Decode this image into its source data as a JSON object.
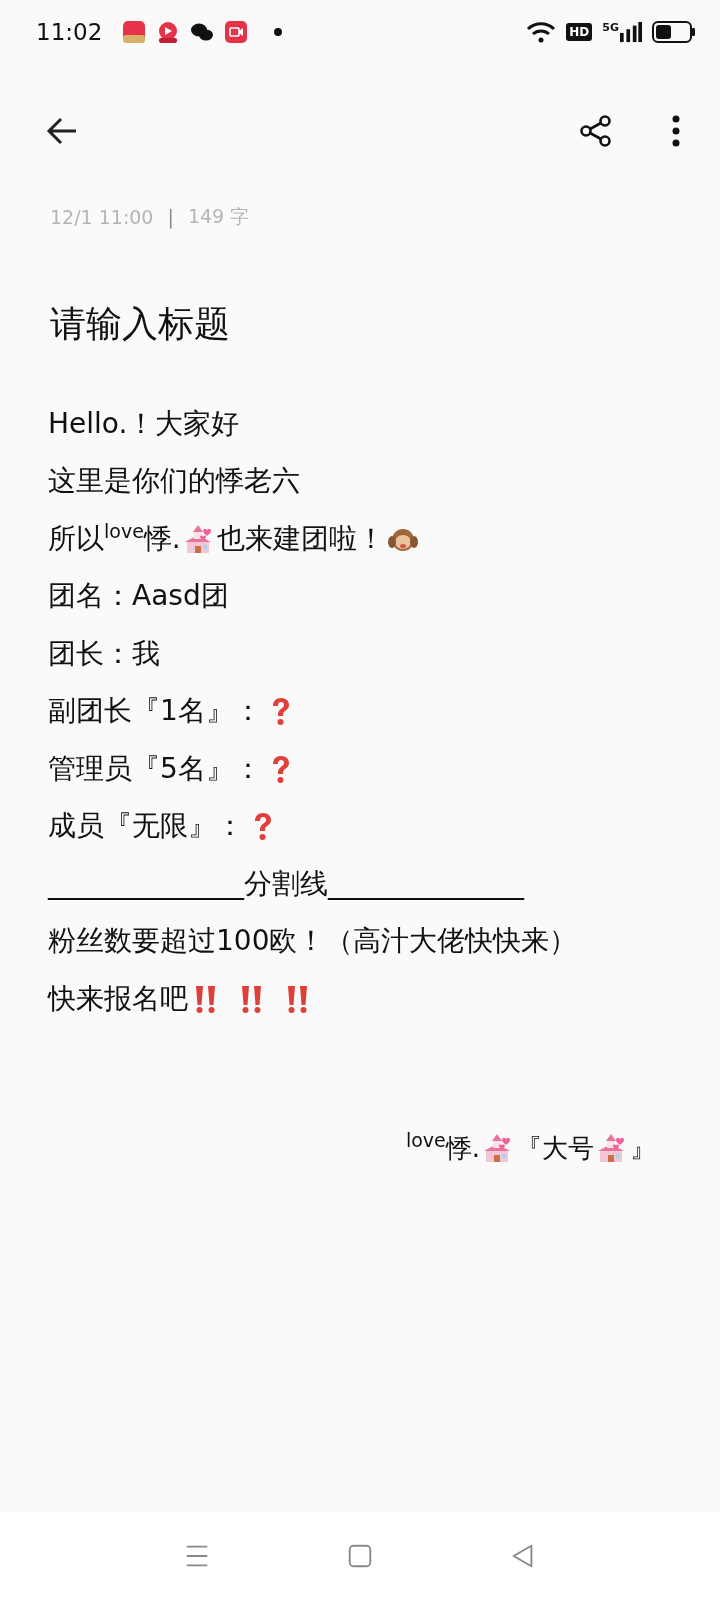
{
  "status_bar": {
    "time": "11:02",
    "hd": "HD",
    "network": "5G"
  },
  "note": {
    "date": "12/1 11:00",
    "separator": "|",
    "count": "149 字",
    "title": "请输入标题",
    "lines": [
      {
        "parts": [
          {
            "kind": "text",
            "text": "Hello.！大家好"
          }
        ]
      },
      {
        "parts": [
          {
            "kind": "text",
            "text": "这里是你们的悸老六"
          }
        ]
      },
      {
        "parts": [
          {
            "kind": "text",
            "text": "所以$^{love}$悸."
          },
          {
            "kind": "chapel"
          },
          {
            "kind": "text",
            "text": "也来建团啦！"
          },
          {
            "kind": "monkey"
          }
        ]
      },
      {
        "parts": [
          {
            "kind": "text",
            "text": "团名：Aasd团"
          }
        ]
      },
      {
        "parts": [
          {
            "kind": "text",
            "text": "团长：我"
          }
        ]
      },
      {
        "parts": [
          {
            "kind": "text",
            "text": "副团长『1名』："
          },
          {
            "kind": "question"
          }
        ]
      },
      {
        "parts": [
          {
            "kind": "text",
            "text": "管理员『5名』："
          },
          {
            "kind": "question"
          }
        ]
      },
      {
        "parts": [
          {
            "kind": "text",
            "text": "成员『无限』："
          },
          {
            "kind": "question"
          }
        ]
      },
      {
        "parts": [
          {
            "kind": "text",
            "text": "______________分割线______________"
          }
        ]
      },
      {
        "parts": [
          {
            "kind": "text",
            "text": "粉丝数要超过100欧！（高汁大佬快快来）"
          }
        ]
      },
      {
        "parts": [
          {
            "kind": "text",
            "text": "快来报名吧"
          },
          {
            "kind": "exclaim"
          },
          {
            "kind": "exclaim"
          },
          {
            "kind": "exclaim"
          }
        ]
      }
    ],
    "signature": {
      "parts": [
        {
          "kind": "text",
          "text": "$^{love}$悸."
        },
        {
          "kind": "chapel"
        },
        {
          "kind": "text",
          "text": "『大号"
        },
        {
          "kind": "chapel"
        },
        {
          "kind": "text",
          "text": "』"
        }
      ]
    }
  }
}
